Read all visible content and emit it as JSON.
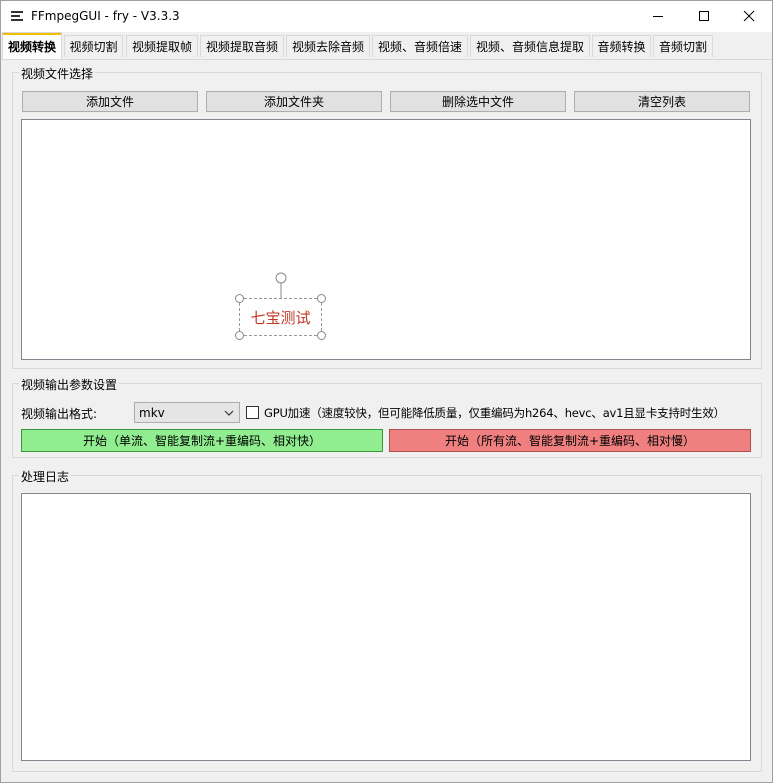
{
  "window": {
    "title": "FFmpegGUI - fry - V3.3.3",
    "controls": [
      "minimize-icon",
      "maximize-icon",
      "close-icon"
    ]
  },
  "tabs": [
    {
      "label": "视频转换",
      "active": true
    },
    {
      "label": "视频切割"
    },
    {
      "label": "视频提取帧"
    },
    {
      "label": "视频提取音频"
    },
    {
      "label": "视频去除音频"
    },
    {
      "label": "视频、音频倍速"
    },
    {
      "label": "视频、音频信息提取"
    },
    {
      "label": "音频转换"
    },
    {
      "label": "音频切割"
    }
  ],
  "file_group": {
    "title": "视频文件选择",
    "buttons": [
      "添加文件",
      "添加文件夹",
      "删除选中文件",
      "清空列表"
    ]
  },
  "watermark": {
    "text": "七宝测试",
    "color": "#c0392b"
  },
  "output_group": {
    "title": "视频输出参数设置",
    "format_label": "视频输出格式:",
    "format_value": "mkv",
    "gpu_label": "GPU加速（速度较快，但可能降低质量，仅重编码为h264、hevc、av1且显卡支持时生效）",
    "gpu_checked": false,
    "start_single": "开始（单流、智能复制流+重编码、相对快）",
    "start_all": "开始（所有流、智能复制流+重编码、相对慢）"
  },
  "colors": {
    "start_single_bg": "#90ee90",
    "start_all_bg": "#f08080",
    "active_tab_accent": "#f0c000"
  },
  "log_group": {
    "title": "处理日志"
  }
}
